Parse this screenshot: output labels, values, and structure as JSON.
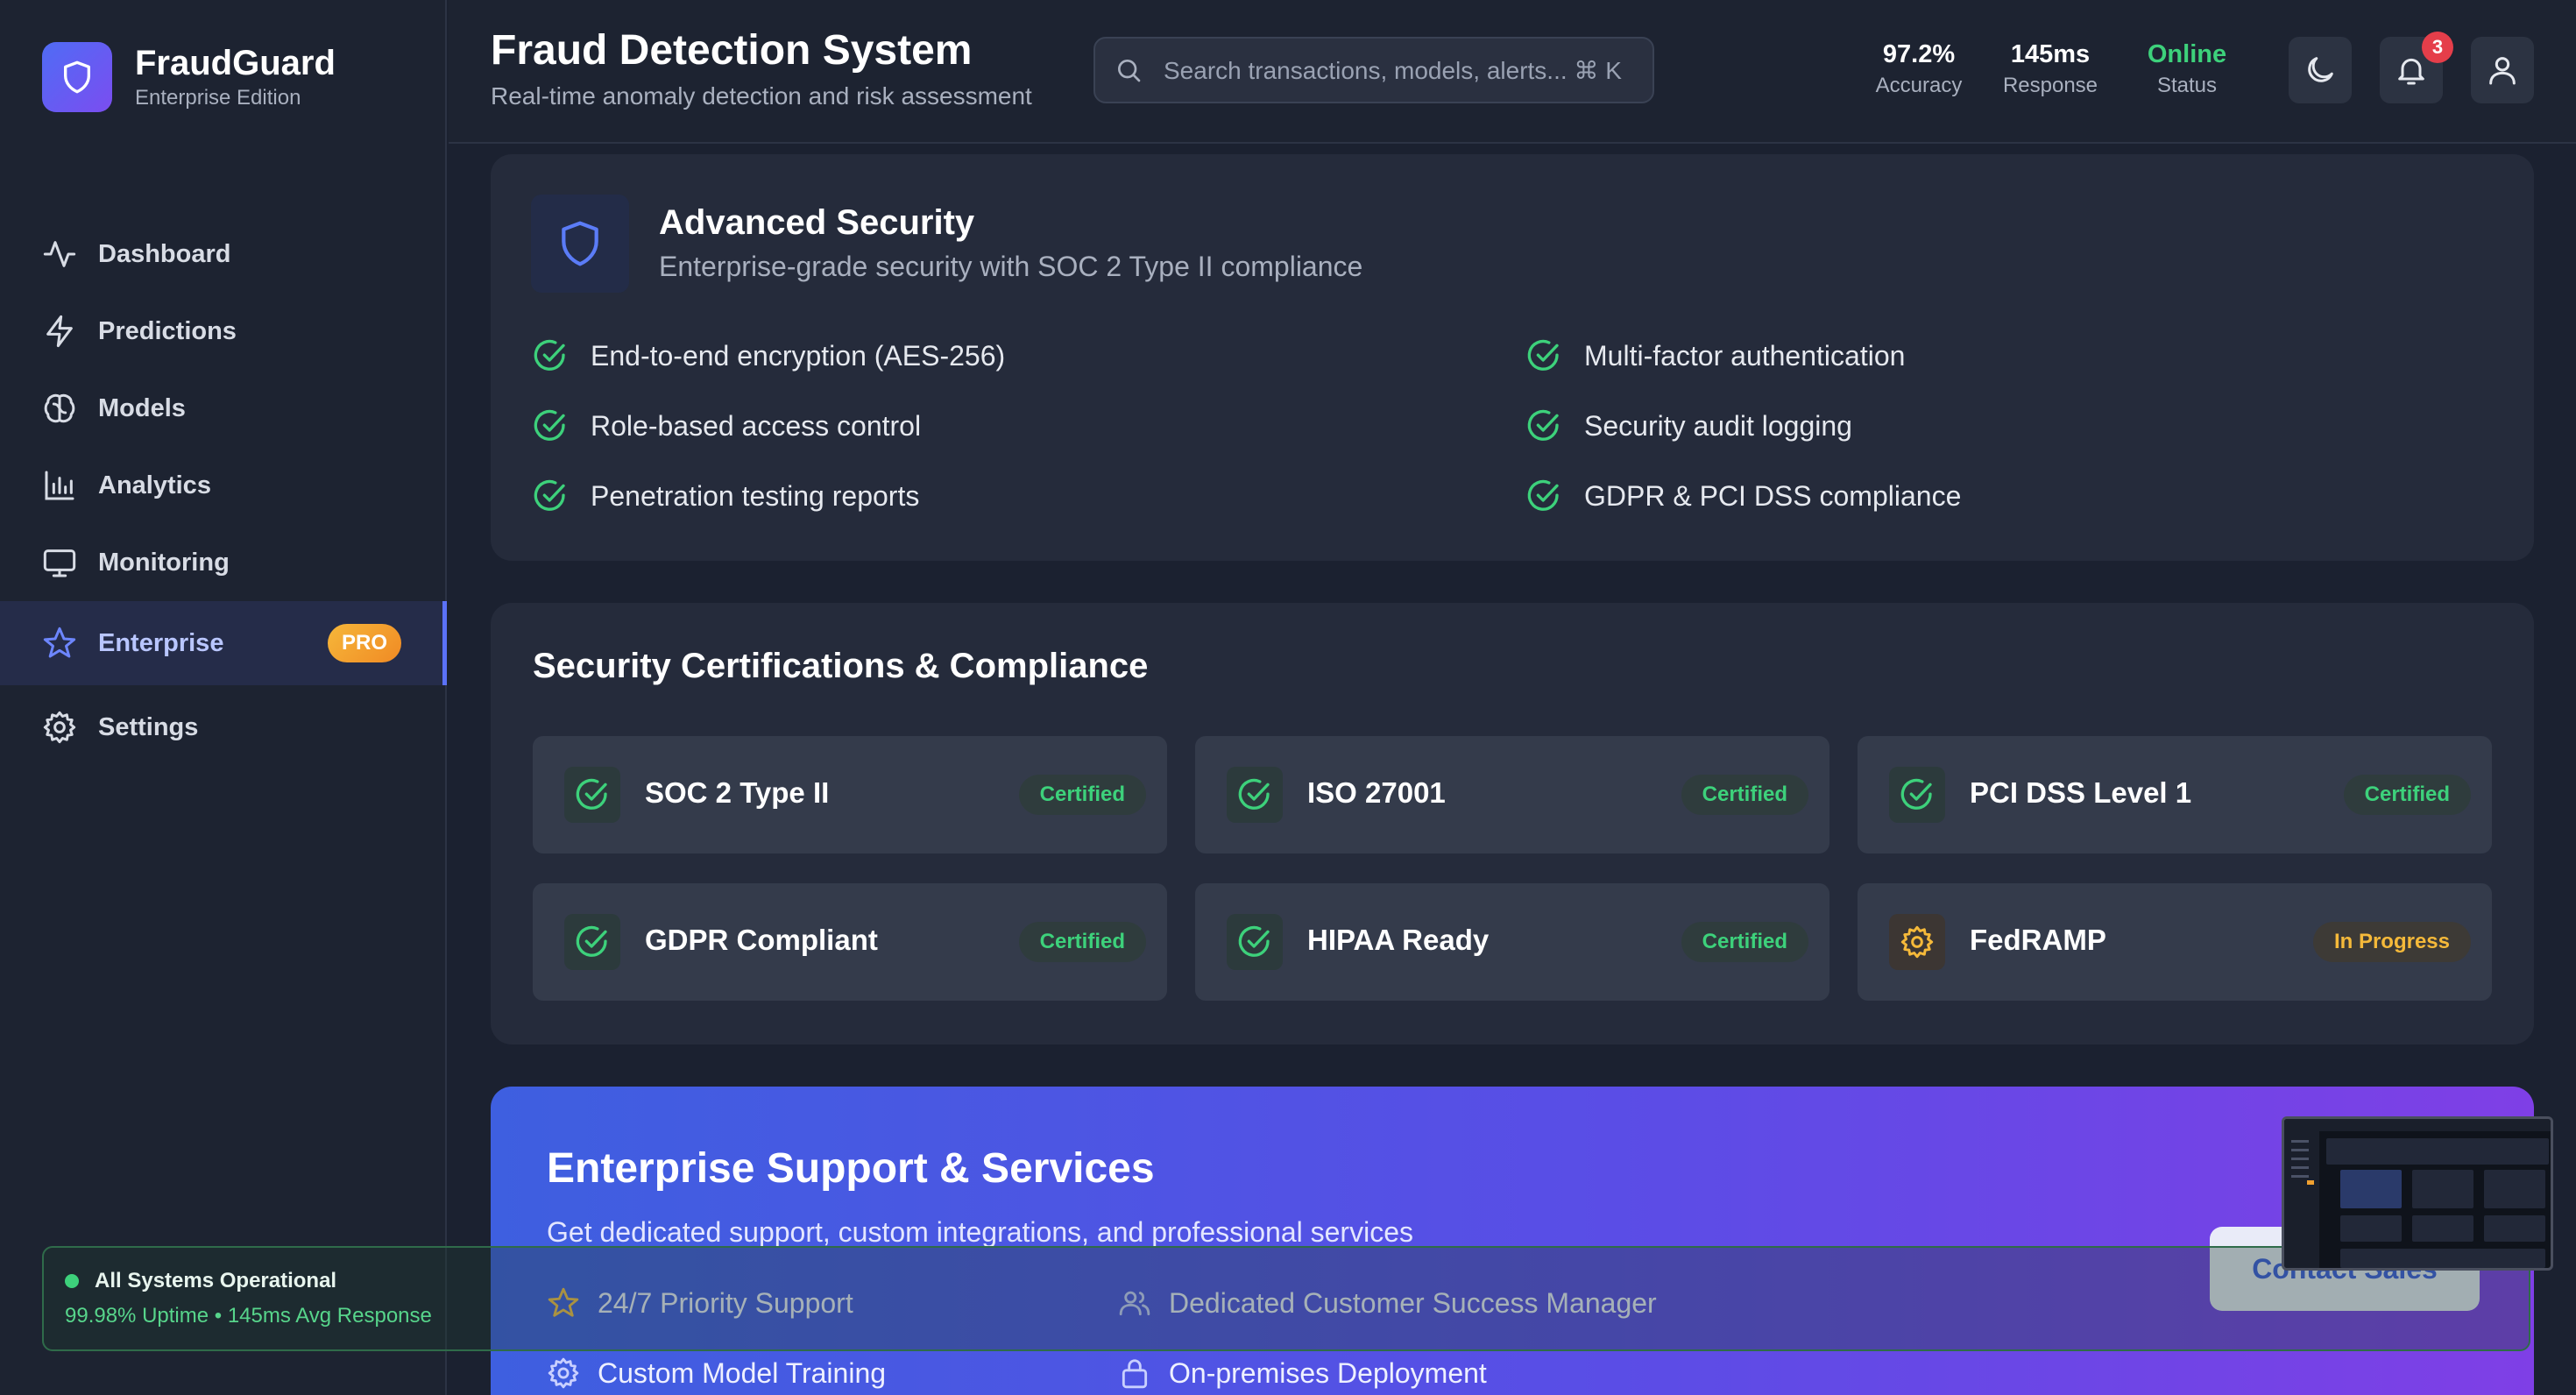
{
  "brand": {
    "name": "FraudGuard",
    "edition": "Enterprise Edition"
  },
  "nav": {
    "items": [
      {
        "label": "Dashboard",
        "icon": "activity-icon"
      },
      {
        "label": "Predictions",
        "icon": "lightning-icon"
      },
      {
        "label": "Models",
        "icon": "brain-icon"
      },
      {
        "label": "Analytics",
        "icon": "bar-chart-icon"
      },
      {
        "label": "Monitoring",
        "icon": "monitor-icon"
      },
      {
        "label": "Enterprise",
        "icon": "star-icon",
        "active": true,
        "badge": "PRO"
      },
      {
        "label": "Settings",
        "icon": "gear-icon"
      }
    ]
  },
  "system_status": {
    "title": "All Systems Operational",
    "detail": "99.98% Uptime • 145ms Avg Response"
  },
  "header": {
    "title": "Fraud Detection System",
    "subtitle": "Real-time anomaly detection and risk assessment",
    "search_placeholder": "Search transactions, models, alerts... ⌘ K",
    "stats": [
      {
        "value": "97.2%",
        "label": "Accuracy"
      },
      {
        "value": "145ms",
        "label": "Response"
      },
      {
        "value": "Online",
        "label": "Status"
      }
    ],
    "notification_count": "3"
  },
  "security": {
    "title": "Advanced Security",
    "subtitle": "Enterprise-grade security with SOC 2 Type II compliance",
    "features": [
      "End-to-end encryption (AES-256)",
      "Multi-factor authentication",
      "Role-based access control",
      "Security audit logging",
      "Penetration testing reports",
      "GDPR & PCI DSS compliance"
    ]
  },
  "certifications": {
    "title": "Security Certifications & Compliance",
    "items": [
      {
        "name": "SOC 2 Type II",
        "status": "Certified"
      },
      {
        "name": "ISO 27001",
        "status": "Certified"
      },
      {
        "name": "PCI DSS Level 1",
        "status": "Certified"
      },
      {
        "name": "GDPR Compliant",
        "status": "Certified"
      },
      {
        "name": "HIPAA Ready",
        "status": "Certified"
      },
      {
        "name": "FedRAMP",
        "status": "In Progress"
      }
    ]
  },
  "support": {
    "title": "Enterprise Support & Services",
    "subtitle": "Get dedicated support, custom integrations, and professional services",
    "items": [
      "24/7 Priority Support",
      "Dedicated Customer Success Manager",
      "Custom Model Training",
      "On-premises Deployment"
    ],
    "cta": "Contact Sales"
  },
  "colors": {
    "accent": "#5b72f7",
    "success": "#3dd17b",
    "warning": "#f5b93a",
    "danger": "#e53e4a"
  }
}
